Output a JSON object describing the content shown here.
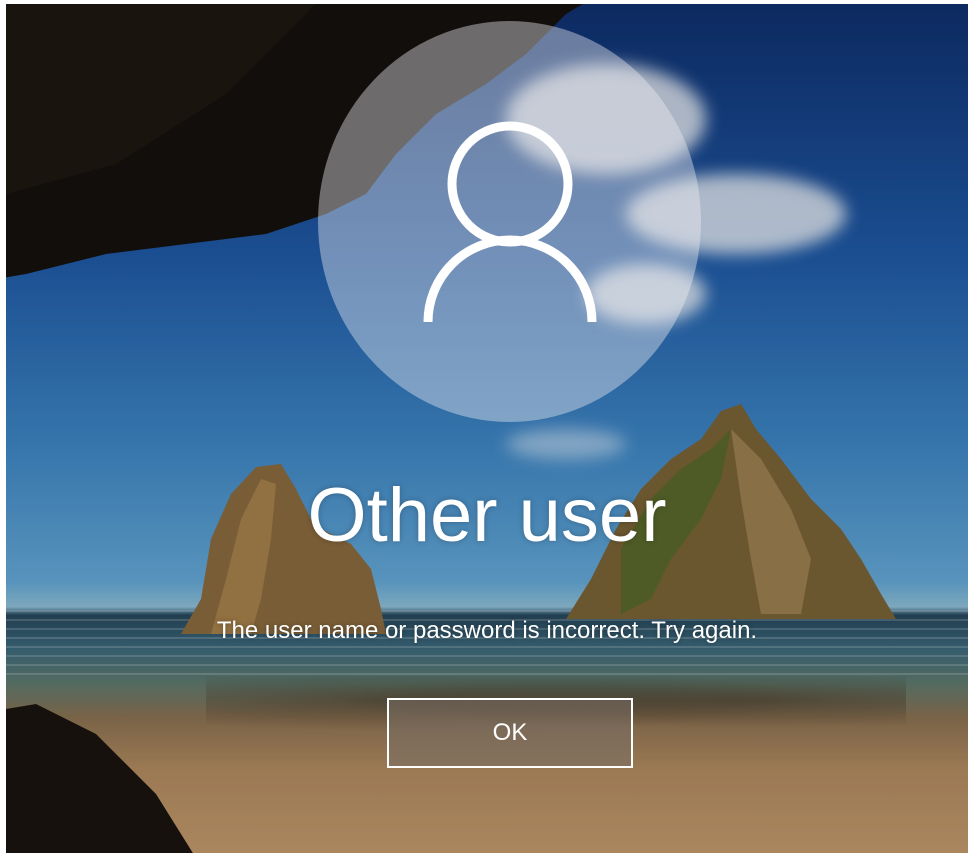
{
  "user": {
    "name": "Other user",
    "avatar_icon": "user-silhouette-icon"
  },
  "error": {
    "message": "The user name or password is incorrect. Try again."
  },
  "actions": {
    "ok_label": "OK"
  },
  "colors": {
    "text": "#ffffff",
    "avatar_fill": "rgba(235,235,240,0.42)",
    "button_border": "#ffffff"
  }
}
